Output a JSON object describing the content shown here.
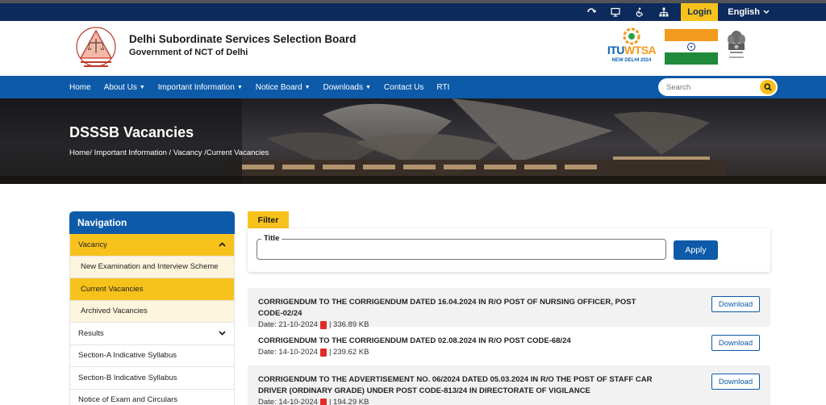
{
  "topbar": {
    "login_label": "Login",
    "language_label": "English",
    "icons": [
      "screen-reader-icon",
      "sitemap-monitor-icon",
      "accessibility-icon",
      "sitemap-icon"
    ]
  },
  "header": {
    "org_name": "Delhi Subordinate Services Selection Board",
    "org_sub": "Government of NCT of Delhi",
    "itu_label_a": "ITU",
    "itu_label_b": "WTSA",
    "itu_sub": "NEW DELHI 2024"
  },
  "nav": {
    "items": [
      {
        "label": "Home",
        "dropdown": false
      },
      {
        "label": "About Us",
        "dropdown": true
      },
      {
        "label": "Important Information",
        "dropdown": true
      },
      {
        "label": "Notice Board",
        "dropdown": true
      },
      {
        "label": "Downloads",
        "dropdown": true
      },
      {
        "label": "Contact Us",
        "dropdown": false
      },
      {
        "label": "RTI",
        "dropdown": false
      }
    ],
    "search_placeholder": "Search"
  },
  "banner": {
    "title": "DSSSB Vacancies",
    "breadcrumb": "Home/ Important Information / Vacancy /Current Vacancies"
  },
  "sidebar": {
    "heading": "Navigation",
    "vacancy": "Vacancy",
    "sub_new_exam": "New Examination and Interview Scheme",
    "sub_current": "Current Vacancies",
    "sub_archived": "Archived Vacancies",
    "results": "Results",
    "section_a": "Section-A Indicative Syllabus",
    "section_b": "Section-B Indicative Syllabus",
    "notice": "Notice of Exam and Circulars"
  },
  "filter": {
    "tab_label": "Filter",
    "title_label": "Title",
    "title_value": "",
    "apply_label": "Apply"
  },
  "vacancies": [
    {
      "title": "CORRIGENDUM TO THE CORRIGENDUM DATED 16.04.2024 IN R/O POST OF NURSING OFFICER, POST CODE-02/24",
      "date": "Date: 21-10-2024",
      "size": "| 336.89 KB",
      "download": "Download"
    },
    {
      "title": "CORRIGENDUM TO THE CORRIGENDUM DATED 02.08.2024 IN R/O POST CODE-68/24",
      "date": "Date: 14-10-2024",
      "size": "| 239.62 KB",
      "download": "Download"
    },
    {
      "title": "CORRIGENDUM TO THE ADVERTISEMENT NO. 06/2024 DATED 05.03.2024 IN R/O THE POST OF STAFF CAR DRIVER (ORDINARY GRADE) UNDER POST CODE-813/24 IN DIRECTORATE OF VIGILANCE",
      "date": "Date: 14-10-2024",
      "size": "| 194.29 KB",
      "download": "Download"
    }
  ],
  "colors": {
    "navy": "#0d2a5c",
    "blue": "#0d5aa8",
    "accent_yellow": "#f7c21b",
    "pdf_red": "#e02b27"
  }
}
